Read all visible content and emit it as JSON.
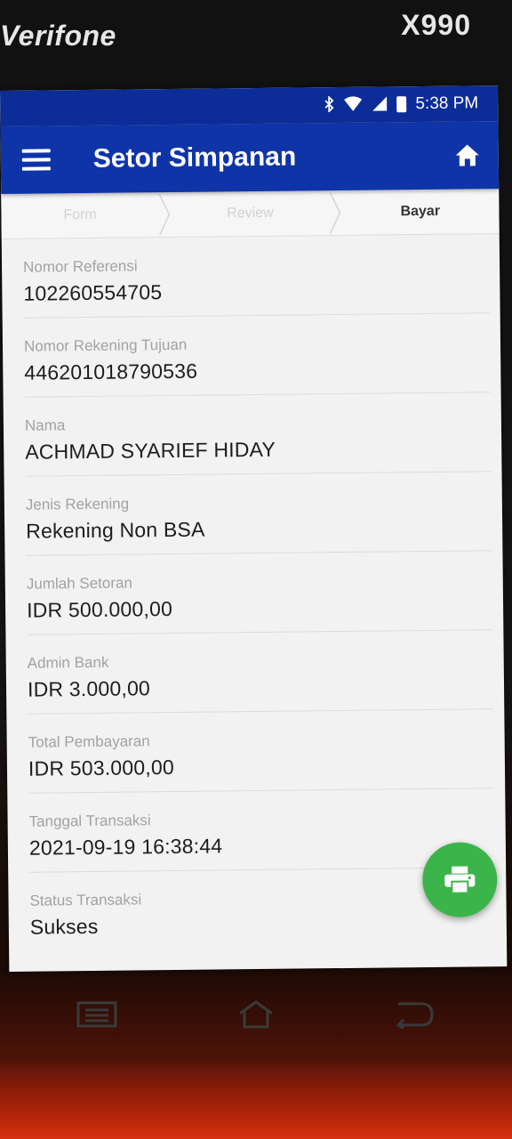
{
  "device": {
    "brand": "Verifone",
    "model": "X990"
  },
  "status_bar": {
    "time": "5:38 PM",
    "icons": [
      "bluetooth-icon",
      "wifi-icon",
      "signal-icon",
      "battery-icon"
    ]
  },
  "app_bar": {
    "title": "Setor Simpanan",
    "menu_icon": "menu-icon",
    "home_icon": "home-icon"
  },
  "stepper": {
    "steps": [
      {
        "label": "Form",
        "active": false
      },
      {
        "label": "Review",
        "active": false
      },
      {
        "label": "Bayar",
        "active": true
      }
    ]
  },
  "fields": [
    {
      "label": "Nomor Referensi",
      "value": "102260554705"
    },
    {
      "label": "Nomor Rekening Tujuan",
      "value": "446201018790536"
    },
    {
      "label": "Nama",
      "value": "ACHMAD SYARIEF HIDAY"
    },
    {
      "label": "Jenis Rekening",
      "value": "Rekening Non BSA"
    },
    {
      "label": "Jumlah Setoran",
      "value": "IDR 500.000,00"
    },
    {
      "label": "Admin Bank",
      "value": "IDR 3.000,00"
    },
    {
      "label": "Total Pembayaran",
      "value": "IDR 503.000,00"
    },
    {
      "label": "Tanggal Transaksi",
      "value": "2021-09-19 16:38:44"
    },
    {
      "label": "Status Transaksi",
      "value": "Sukses"
    }
  ],
  "fab": {
    "icon": "print-icon",
    "color": "#3bb54a"
  },
  "navigation": {
    "buttons": [
      "recent-apps-icon",
      "home-nav-icon",
      "back-icon"
    ]
  },
  "colors": {
    "status_bar": "#0c2d97",
    "app_bar": "#0e34a8",
    "background": "#f2f2f2"
  }
}
